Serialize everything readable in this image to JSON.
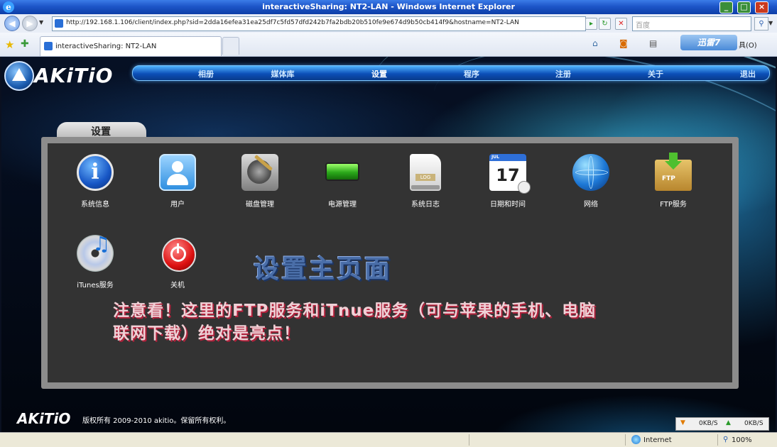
{
  "window": {
    "title": "interactiveSharing: NT2-LAN - Windows Internet Explorer",
    "address": "http://192.168.1.106/client/index.php?sid=2dda16efea31ea25df7c5fd57dfd242b7fa2bdb20b510fe9e674d9b50cb414f9&hostname=NT2-LAN",
    "search_placeholder": "百度",
    "tab_label": "interactiveSharing: NT2-LAN",
    "xunlei_label": "迅雷7",
    "tools_label": "具(O)"
  },
  "site": {
    "logo": "AKiTiO",
    "nav": [
      "相册",
      "媒体库",
      "设置",
      "程序",
      "注册",
      "关于",
      "退出"
    ],
    "active_nav": "设置"
  },
  "panel": {
    "tab_title": "设置",
    "items": [
      {
        "label": "系统信息",
        "icon": "info-icon"
      },
      {
        "label": "用户",
        "icon": "user-icon"
      },
      {
        "label": "磁盘管理",
        "icon": "disk-icon"
      },
      {
        "label": "电源管理",
        "icon": "battery-icon"
      },
      {
        "label": "系统日志",
        "icon": "log-icon"
      },
      {
        "label": "日期和时间",
        "icon": "calendar-icon"
      },
      {
        "label": "网络",
        "icon": "globe-icon"
      },
      {
        "label": "FTP服务",
        "icon": "ftp-icon"
      },
      {
        "label": "iTunes服务",
        "icon": "itunes-icon"
      },
      {
        "label": "关机",
        "icon": "power-icon"
      }
    ],
    "log_badge": "LOG",
    "calendar_month": "JUL",
    "calendar_day": "17",
    "ftp_badge": "FTP"
  },
  "overlay": {
    "title": "设置主页面",
    "annotation_line1": "注意看！这里的FTP服务和iTnue服务（可与苹果的手机、电脑",
    "annotation_line2": "联网下载）绝对是亮点！"
  },
  "footer": {
    "logo": "AKiTiO",
    "copyright": "版权所有 2009-2010 akitio。保留所有权利。",
    "download_speed": "0KB/S",
    "upload_speed": "0KB/S"
  },
  "status": {
    "zone": "Internet",
    "zoom": "100%"
  }
}
